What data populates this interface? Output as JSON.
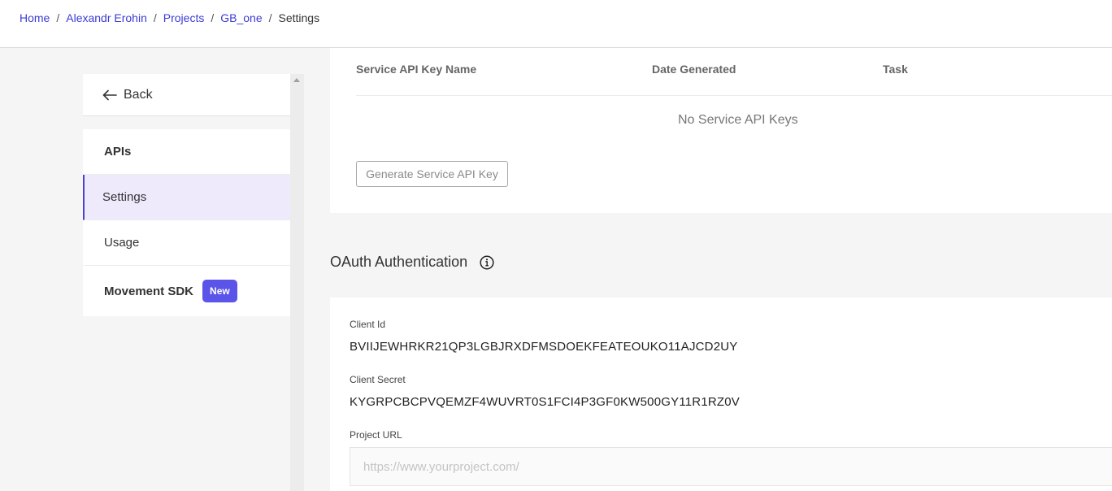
{
  "breadcrumb": {
    "items": [
      "Home",
      "Alexandr Erohin",
      "Projects",
      "GB_one"
    ],
    "current": "Settings",
    "separator": "/"
  },
  "sidebar": {
    "back_label": "Back",
    "items": [
      {
        "label": "APIs"
      },
      {
        "label": "Settings"
      },
      {
        "label": "Usage"
      },
      {
        "label": "Movement SDK",
        "badge": "New"
      }
    ]
  },
  "service_keys": {
    "columns": [
      "Service API Key Name",
      "Date Generated",
      "Task"
    ],
    "empty_text": "No Service API Keys",
    "generate_label": "Generate Service API Key"
  },
  "oauth": {
    "title": "OAuth Authentication",
    "client_id_label": "Client Id",
    "client_id": "BVIIJEWHRKR21QP3LGBJRXDFMSDOEKFEATEOUKO11AJCD2UY",
    "client_secret_label": "Client Secret",
    "client_secret": "KYGRPCBCPVQEMZF4WUVRT0S1FCI4P3GF0KW500GY11R1RZ0V",
    "project_url_label": "Project URL",
    "project_url_placeholder": "https://www.yourproject.com/"
  },
  "colors": {
    "accent": "#4b3fd4",
    "link": "#3b3bd6",
    "badge": "#5b54e8",
    "active_bg": "#eeeafc"
  },
  "icons": [
    "arrow-left-icon",
    "info-icon",
    "scroll-up-arrow-icon"
  ]
}
